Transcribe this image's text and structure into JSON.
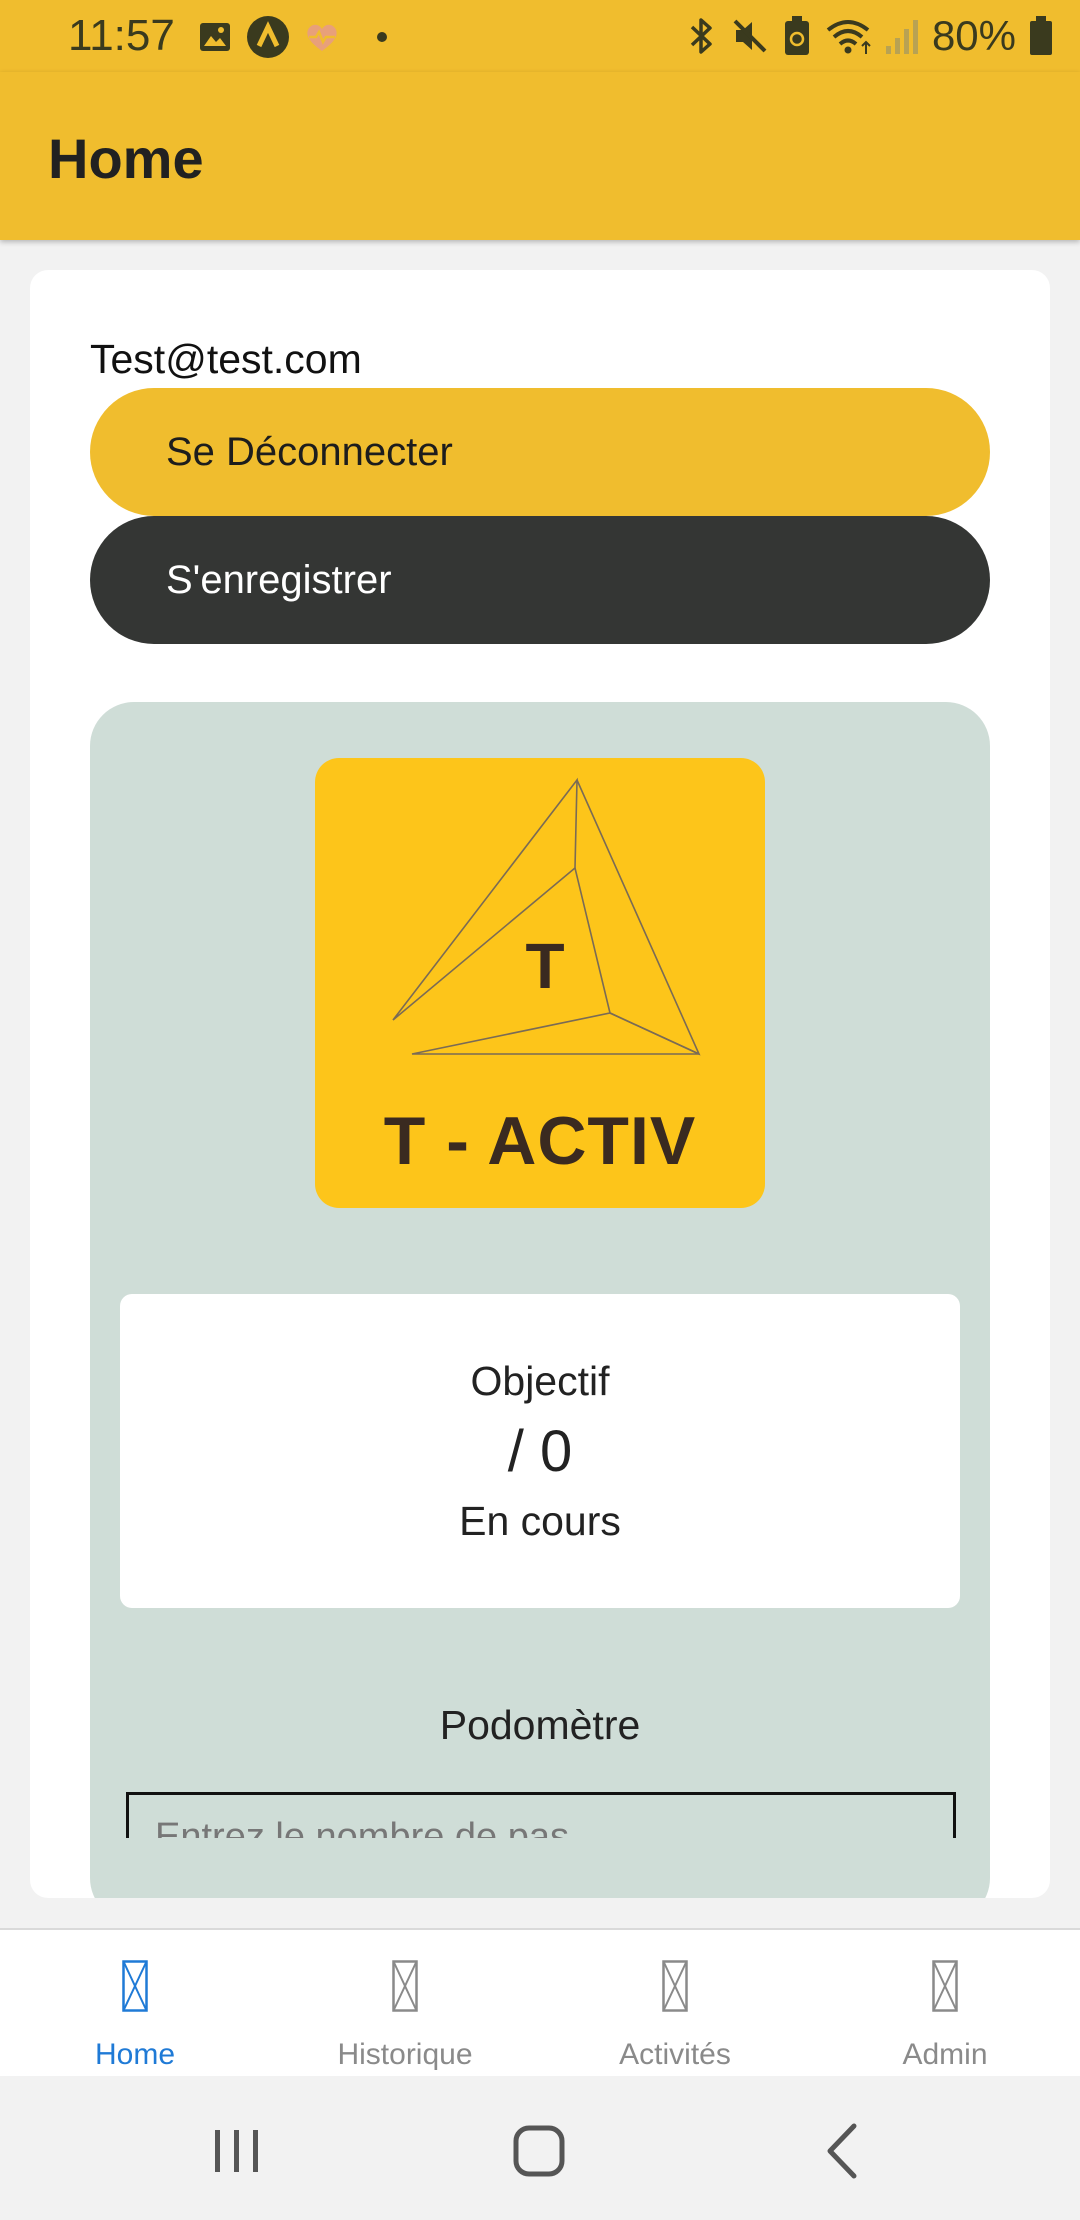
{
  "status_bar": {
    "time": "11:57",
    "battery_percent": "80%",
    "left_icons": [
      "image-icon",
      "a-circle-icon",
      "heart-pulse-icon",
      "dot-icon"
    ],
    "right_icons": [
      "bluetooth-icon",
      "mute-icon",
      "battery-saver-icon",
      "wifi-icon",
      "signal-icon",
      "battery-icon"
    ]
  },
  "app_bar": {
    "title": "Home"
  },
  "account": {
    "email": "Test@test.com",
    "logout_label": "Se Déconnecter",
    "register_label": "S'enregistrer"
  },
  "logo": {
    "letter": "T",
    "text": "T - ACTIV"
  },
  "goal": {
    "title": "Objectif",
    "value": "/ 0",
    "status": "En cours"
  },
  "pedometer": {
    "title": "Podomètre",
    "placeholder": "Entrez le nombre de pas"
  },
  "tabs": [
    {
      "label": "Home",
      "icon": "missing-glyph-icon",
      "active": true
    },
    {
      "label": "Historique",
      "icon": "missing-glyph-icon",
      "active": false
    },
    {
      "label": "Activités",
      "icon": "missing-glyph-icon",
      "active": false
    },
    {
      "label": "Admin",
      "icon": "missing-glyph-icon",
      "active": false
    }
  ],
  "colors": {
    "primary_yellow": "#f0bd2e",
    "logo_yellow": "#fdc51a",
    "dark_button": "#343634",
    "panel_bg": "#cfddd7",
    "active_tab": "#1f7ad6",
    "inactive_tab": "#8a8a8a"
  }
}
